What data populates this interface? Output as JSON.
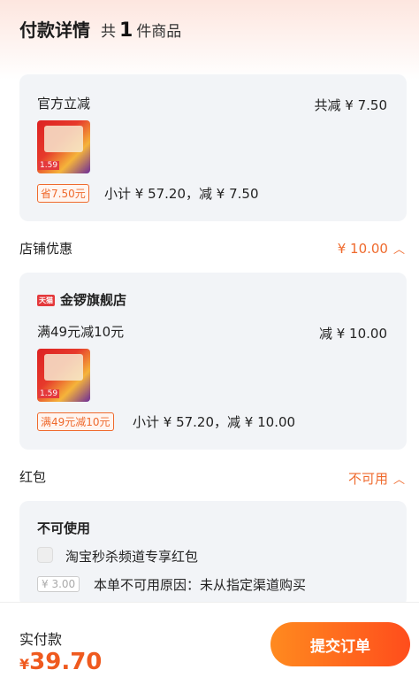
{
  "header": {
    "title": "付款详情",
    "count_prefix": "共",
    "count": "1",
    "count_suffix": "件商品"
  },
  "official_discount": {
    "label": "官方立减",
    "total_label": "共减 ¥ 7.50",
    "thumb_price": "1.59",
    "tag": "省7.50元",
    "subtotal": "小计 ¥ 57.20，减 ¥ 7.50"
  },
  "shop_discount": {
    "section_label": "店铺优惠",
    "section_value": "¥ 10.00",
    "store_badge": "天猫",
    "store_name": "金锣旗舰店",
    "rule": "满49元减10元",
    "rule_value": "减 ¥ 10.00",
    "thumb_price": "1.59",
    "tag": "满49元减10元",
    "subtotal": "小计 ¥ 57.20，减 ¥ 10.00"
  },
  "red_packet": {
    "section_label": "红包",
    "section_value": "不可用",
    "card_title": "不可使用",
    "item_name": "淘宝秒杀频道专享红包",
    "item_tag": "¥ 3.00",
    "reason": "本单不可用原因：未从指定渠道购买"
  },
  "footer": {
    "pay_label": "实付款",
    "currency": "¥",
    "amount": "39.70",
    "submit_label": "提交订单"
  },
  "colors": {
    "accent": "#ef6a2d",
    "card_bg": "#f2f4f7"
  }
}
